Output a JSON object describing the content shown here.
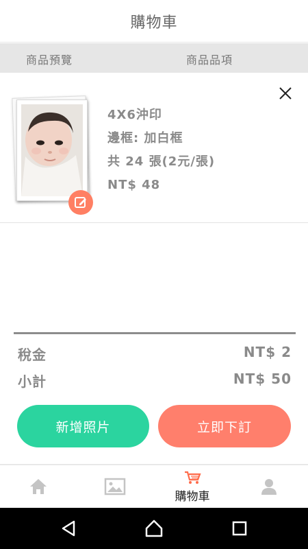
{
  "header": {
    "title": "購物車"
  },
  "columns": {
    "preview": "商品預覽",
    "items": "商品品項"
  },
  "cart_item": {
    "size": "4X6沖印",
    "border": "邊框: 加白框",
    "quantity": "共 24 張(2元/張)",
    "price": "NT$ 48",
    "edit_icon": "edit-icon",
    "remove_icon": "close-icon"
  },
  "summary": {
    "tax_label": "稅金",
    "tax_value": "NT$ 2",
    "subtotal_label": "小計",
    "subtotal_value": "NT$ 50"
  },
  "buttons": {
    "add_photo": "新增照片",
    "order_now": "立即下訂"
  },
  "tabs": [
    {
      "name": "home",
      "icon": "home-icon",
      "label": ""
    },
    {
      "name": "photos",
      "icon": "image-icon",
      "label": ""
    },
    {
      "name": "cart",
      "icon": "cart-icon",
      "label": "購物車"
    },
    {
      "name": "profile",
      "icon": "person-icon",
      "label": ""
    }
  ],
  "colors": {
    "accent_green": "#2bd49f",
    "accent_coral": "#ff7f6c",
    "active_tab": "#ff6b4a"
  }
}
